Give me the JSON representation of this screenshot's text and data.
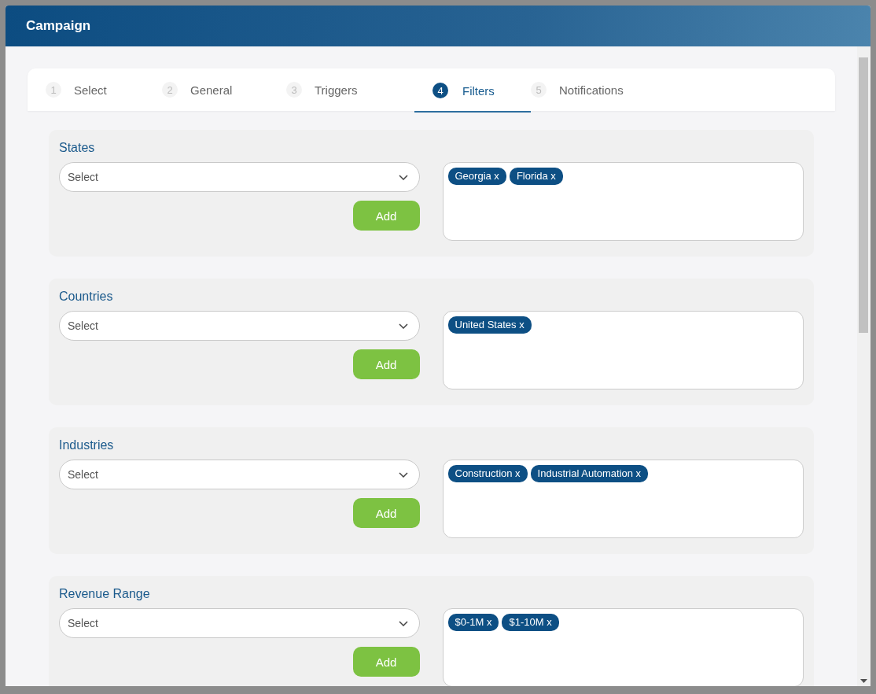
{
  "window": {
    "title": "Campaign"
  },
  "tabs": [
    {
      "number": "1",
      "label": "Select",
      "selected": false
    },
    {
      "number": "2",
      "label": "General",
      "selected": false
    },
    {
      "number": "3",
      "label": "Triggers",
      "selected": false
    },
    {
      "number": "4",
      "label": "Filters",
      "selected": true
    },
    {
      "number": "5",
      "label": "Notifications",
      "selected": false
    }
  ],
  "sections": [
    {
      "title": "States",
      "select_placeholder": "Select",
      "add_button": "Add",
      "tags": [
        "Georgia x",
        "Florida x"
      ]
    },
    {
      "title": "Countries",
      "select_placeholder": "Select",
      "add_button": "Add",
      "tags": [
        "United States x"
      ]
    },
    {
      "title": "Industries",
      "select_placeholder": "Select",
      "add_button": "Add",
      "tags": [
        "Construction x",
        "Industrial Automation x"
      ]
    },
    {
      "title": "Revenue Range",
      "select_placeholder": "Select",
      "add_button": "Add",
      "tags": [
        "$0-1M x",
        "$1-10M x"
      ]
    }
  ]
}
